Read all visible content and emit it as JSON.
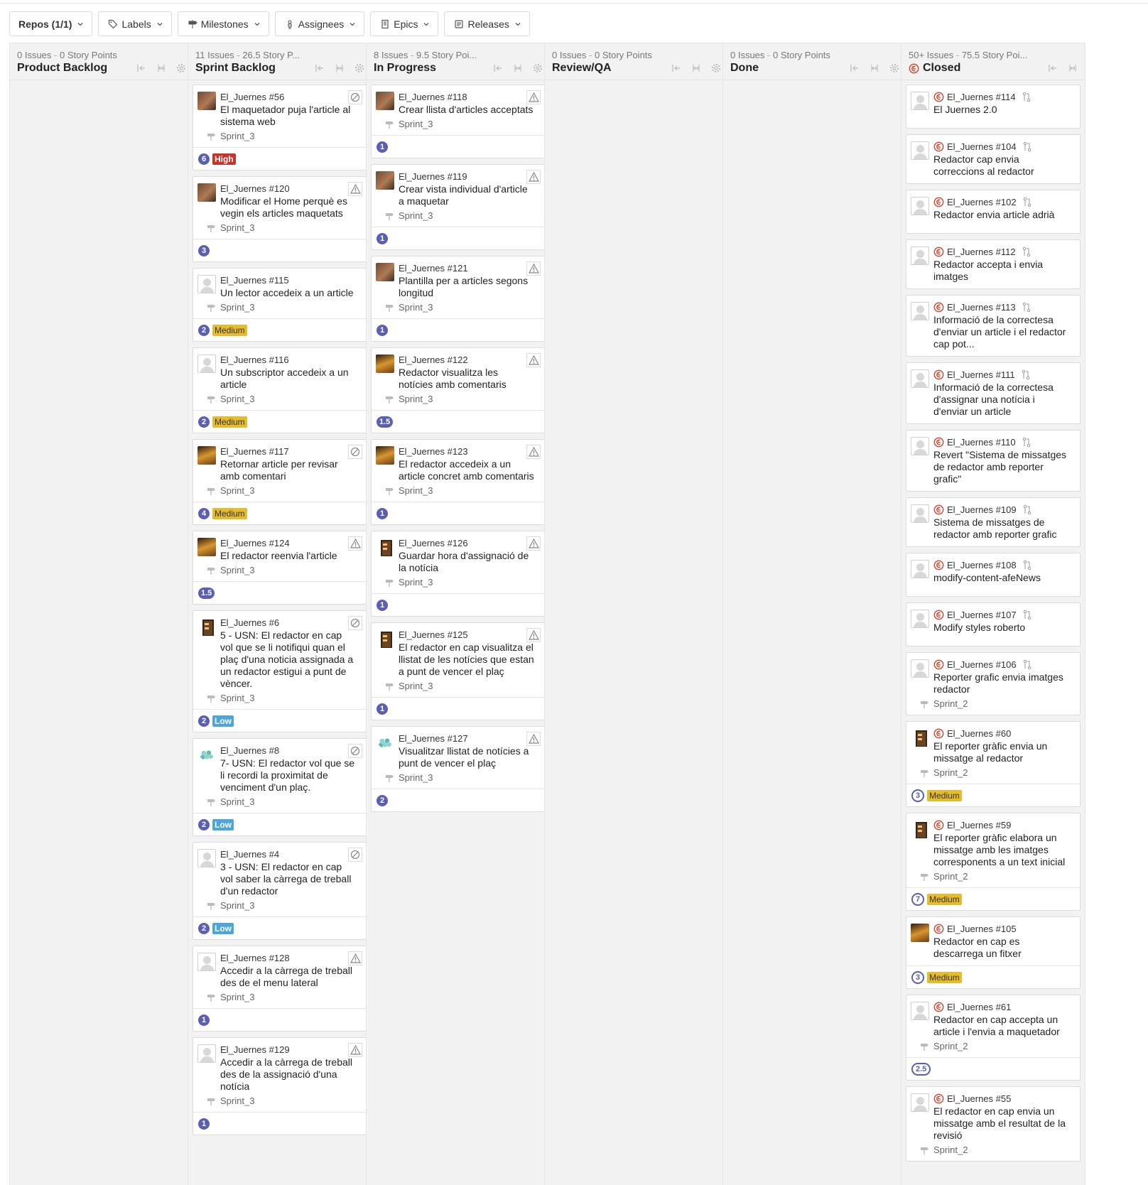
{
  "colors": {
    "points": "#5a5fb3",
    "high": "#c7322a",
    "medium": "#e5bc2b",
    "low": "#4aa6db",
    "closed": "#d0432e"
  },
  "filters": [
    {
      "label": "Repos (1/1)",
      "icon": "",
      "name": "repos-filter"
    },
    {
      "label": "Labels",
      "icon": "tag-icon",
      "name": "labels-filter"
    },
    {
      "label": "Milestones",
      "icon": "milestone-icon",
      "name": "milestones-filter"
    },
    {
      "label": "Assignees",
      "icon": "person-icon",
      "name": "assignees-filter"
    },
    {
      "label": "Epics",
      "icon": "epic-icon",
      "name": "epics-filter"
    },
    {
      "label": "Releases",
      "icon": "release-icon",
      "name": "releases-filter"
    }
  ],
  "columns": [
    {
      "id": "product-backlog",
      "issues": "0 Issues",
      "points": "0 Story Points",
      "title": "Product Backlog",
      "closed": false,
      "cards": []
    },
    {
      "id": "sprint-backlog",
      "issues": "11 Issues",
      "points": "26.5 Story P...",
      "title": "Sprint Backlog",
      "closed": false,
      "cards": [
        {
          "ref": "El_Juernes #56",
          "title": "El maquetador puja l'article al sistema web",
          "sprint": "Sprint_3",
          "avatar": "photo1",
          "flag": "blocked",
          "points": "6",
          "label": "High"
        },
        {
          "ref": "El_Juernes #120",
          "title": "Modificar el Home perquè es vegin els articles maquetats",
          "sprint": "Sprint_3",
          "avatar": "photo1",
          "flag": "warning",
          "points": "3",
          "label": ""
        },
        {
          "ref": "El_Juernes #115",
          "title": "Un lector accedeix a un article",
          "sprint": "Sprint_3",
          "avatar": "default",
          "flag": "",
          "points": "2",
          "label": "Medium"
        },
        {
          "ref": "El_Juernes #116",
          "title": "Un subscriptor accedeix a un article",
          "sprint": "Sprint_3",
          "avatar": "default",
          "flag": "",
          "points": "2",
          "label": "Medium"
        },
        {
          "ref": "El_Juernes #117",
          "title": "Retornar article per revisar amb comentari",
          "sprint": "Sprint_3",
          "avatar": "photo2",
          "flag": "blocked",
          "points": "4",
          "label": "Medium"
        },
        {
          "ref": "El_Juernes #124",
          "title": "El redactor reenvia l'article",
          "sprint": "Sprint_3",
          "avatar": "photo2",
          "flag": "warning",
          "points": "1.5",
          "label": ""
        },
        {
          "ref": "El_Juernes #6",
          "title": "5 - USN: El redactor en cap vol que se li notifiqui quan el plaç d'una noticia assignada a un redactor estigui a punt de vèncer.",
          "sprint": "Sprint_3",
          "avatar": "pixel",
          "flag": "blocked",
          "points": "2",
          "label": "Low"
        },
        {
          "ref": "El_Juernes #8",
          "title": "7- USN: El redactor vol que se li recordi la proximitat de venciment d'un plaç.",
          "sprint": "Sprint_3",
          "avatar": "ident",
          "flag": "blocked",
          "points": "2",
          "label": "Low"
        },
        {
          "ref": "El_Juernes #4",
          "title": "3 - USN: El redactor en cap vol saber la càrrega de treball d'un redactor",
          "sprint": "Sprint_3",
          "avatar": "default",
          "flag": "blocked",
          "points": "2",
          "label": "Low"
        },
        {
          "ref": "El_Juernes #128",
          "title": "Accedir a la càrrega de treball des de el menu lateral",
          "sprint": "Sprint_3",
          "avatar": "default",
          "flag": "warning",
          "points": "1",
          "label": ""
        },
        {
          "ref": "El_Juernes #129",
          "title": "Accedir a la càrrega de treball des de la assignació d'una notícia",
          "sprint": "Sprint_3",
          "avatar": "default",
          "flag": "warning",
          "points": "1",
          "label": ""
        }
      ]
    },
    {
      "id": "in-progress",
      "issues": "8 Issues",
      "points": "9.5 Story Poi...",
      "title": "In Progress",
      "closed": false,
      "cards": [
        {
          "ref": "El_Juernes #118",
          "title": "Crear llista d'articles acceptats",
          "sprint": "Sprint_3",
          "avatar": "photo1",
          "flag": "warning",
          "points": "1",
          "label": ""
        },
        {
          "ref": "El_Juernes #119",
          "title": "Crear vista individual d'article a maquetar",
          "sprint": "Sprint_3",
          "avatar": "photo1",
          "flag": "warning",
          "points": "1",
          "label": ""
        },
        {
          "ref": "El_Juernes #121",
          "title": "Plantilla per a articles segons longitud",
          "sprint": "Sprint_3",
          "avatar": "photo1",
          "flag": "warning",
          "points": "1",
          "label": ""
        },
        {
          "ref": "El_Juernes #122",
          "title": "Redactor visualitza les notícies amb comentaris",
          "sprint": "Sprint_3",
          "avatar": "photo2",
          "flag": "warning",
          "points": "1.5",
          "label": ""
        },
        {
          "ref": "El_Juernes #123",
          "title": "El redactor accedeix a un article concret amb comentaris",
          "sprint": "Sprint_3",
          "avatar": "photo2",
          "flag": "warning",
          "points": "1",
          "label": ""
        },
        {
          "ref": "El_Juernes #126",
          "title": "Guardar hora d'assignació de la notícia",
          "sprint": "Sprint_3",
          "avatar": "pixel",
          "flag": "warning",
          "points": "1",
          "label": ""
        },
        {
          "ref": "El_Juernes #125",
          "title": "El redactor en cap visualitza el llistat de les notícies que estan a punt de vencer el plaç",
          "sprint": "Sprint_3",
          "avatar": "pixel",
          "flag": "warning",
          "points": "1",
          "label": ""
        },
        {
          "ref": "El_Juernes #127",
          "title": "Visualitzar llistat de notícies a punt de vencer el plaç",
          "sprint": "Sprint_3",
          "avatar": "ident",
          "flag": "warning",
          "points": "2",
          "label": ""
        }
      ]
    },
    {
      "id": "review-qa",
      "issues": "0 Issues",
      "points": "0 Story Points",
      "title": "Review/QA",
      "closed": false,
      "cards": []
    },
    {
      "id": "done",
      "issues": "0 Issues",
      "points": "0 Story Points",
      "title": "Done",
      "closed": false,
      "cards": []
    },
    {
      "id": "closed",
      "issues": "50+ Issues",
      "points": "75.5 Story Poi...",
      "title": "Closed",
      "closed": true,
      "cards": [
        {
          "ref": "El_Juernes #114",
          "title": "El Juernes 2.0",
          "sprint": "",
          "avatar": "default",
          "pr": true,
          "points": "",
          "label": ""
        },
        {
          "ref": "El_Juernes #104",
          "title": "Redactor cap envia correccions al redactor",
          "sprint": "",
          "avatar": "default",
          "pr": true,
          "points": "",
          "label": ""
        },
        {
          "ref": "El_Juernes #102",
          "title": "Redactor envia article adrià",
          "sprint": "",
          "avatar": "default",
          "pr": true,
          "points": "",
          "label": ""
        },
        {
          "ref": "El_Juernes #112",
          "title": "Redactor accepta i envia imatges",
          "sprint": "",
          "avatar": "default",
          "pr": true,
          "points": "",
          "label": ""
        },
        {
          "ref": "El_Juernes #113",
          "title": "Informació de la correctesa d'enviar un article i el redactor cap pot...",
          "sprint": "",
          "avatar": "default",
          "pr": true,
          "points": "",
          "label": ""
        },
        {
          "ref": "El_Juernes #111",
          "title": "Informació de la correctesa d'assignar una notícia i d'enviar un article",
          "sprint": "",
          "avatar": "default",
          "pr": true,
          "points": "",
          "label": ""
        },
        {
          "ref": "El_Juernes #110",
          "title": "Revert \"Sistema de missatges de redactor amb reporter grafic\"",
          "sprint": "",
          "avatar": "default",
          "pr": true,
          "points": "",
          "label": ""
        },
        {
          "ref": "El_Juernes #109",
          "title": "Sistema de missatges de redactor amb reporter grafic",
          "sprint": "",
          "avatar": "default",
          "pr": true,
          "points": "",
          "label": ""
        },
        {
          "ref": "El_Juernes #108",
          "title": "modify-content-afeNews",
          "sprint": "",
          "avatar": "default",
          "pr": true,
          "points": "",
          "label": ""
        },
        {
          "ref": "El_Juernes #107",
          "title": "Modify styles roberto",
          "sprint": "",
          "avatar": "default",
          "pr": true,
          "points": "",
          "label": ""
        },
        {
          "ref": "El_Juernes #106",
          "title": "Reporter grafic envia imatges redactor",
          "sprint": "Sprint_2",
          "avatar": "default",
          "pr": true,
          "points": "",
          "label": ""
        },
        {
          "ref": "El_Juernes #60",
          "title": "El reporter gràfic envia un missatge al redactor",
          "sprint": "Sprint_2",
          "avatar": "pixel",
          "pr": false,
          "points": "3",
          "label": "Medium"
        },
        {
          "ref": "El_Juernes #59",
          "title": "El reporter gràfic elabora un missatge amb les imatges corresponents a un text inicial",
          "sprint": "Sprint_2",
          "avatar": "pixel",
          "pr": false,
          "points": "7",
          "label": "Medium"
        },
        {
          "ref": "El_Juernes #105",
          "title": "Redactor en cap es descarrega un fitxer",
          "sprint": "",
          "avatar": "photo2",
          "pr": false,
          "points": "3",
          "label": "Medium"
        },
        {
          "ref": "El_Juernes #61",
          "title": "Redactor en cap accepta un article i l'envia a maquetador",
          "sprint": "Sprint_2",
          "avatar": "default",
          "pr": false,
          "points": "2.5",
          "label": ""
        },
        {
          "ref": "El_Juernes #55",
          "title": "El redactor en cap envia un missatge amb el resultat de la revisió",
          "sprint": "Sprint_2",
          "avatar": "default",
          "pr": false,
          "points": "",
          "label": ""
        }
      ]
    }
  ]
}
